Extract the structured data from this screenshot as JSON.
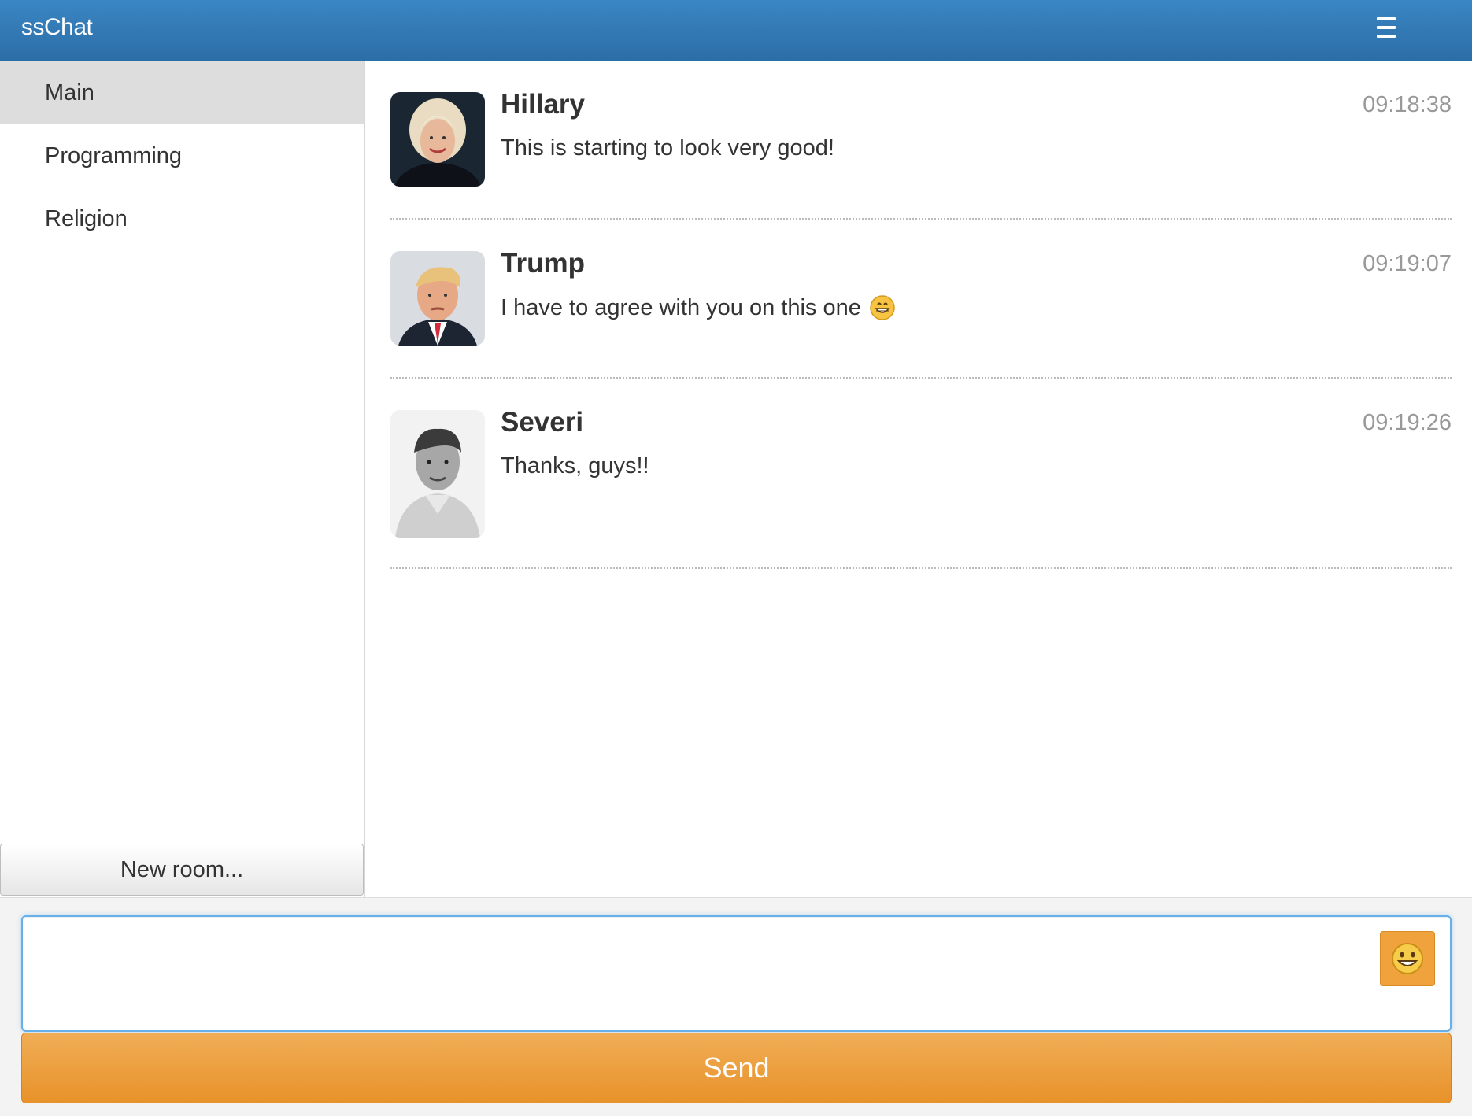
{
  "app": {
    "title": "ssChat"
  },
  "header": {
    "menu_icon": "hamburger-menu-icon"
  },
  "sidebar": {
    "rooms": [
      {
        "label": "Main",
        "active": true
      },
      {
        "label": "Programming",
        "active": false
      },
      {
        "label": "Religion",
        "active": false
      }
    ],
    "new_room_label": "New room..."
  },
  "messages": [
    {
      "author": "Hillary",
      "time": "09:18:38",
      "text": "This is starting to look very good!",
      "emoji": ""
    },
    {
      "author": "Trump",
      "time": "09:19:07",
      "text": "I have to agree with you on this one",
      "emoji": "grinning-face-icon"
    },
    {
      "author": "Severi",
      "time": "09:19:26",
      "text": "Thanks, guys!!",
      "emoji": ""
    }
  ],
  "composer": {
    "input_value": "",
    "emoji_icon": "smiley-face-icon",
    "send_label": "Send"
  },
  "colors": {
    "navbar": "#2f78b5",
    "accent_orange": "#ec9a36",
    "active_room": "#dddddd",
    "timestamp": "#999999"
  }
}
